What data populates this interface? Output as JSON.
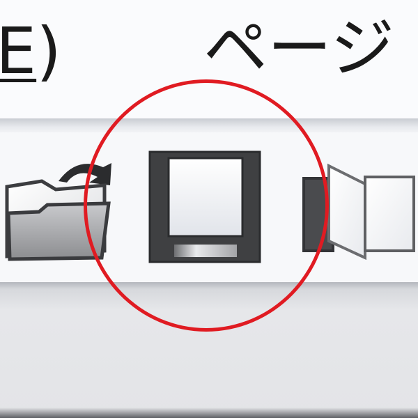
{
  "menubar": {
    "edit_label": "E)",
    "edit_mnemonic": "E",
    "edit_close": ")",
    "page_label": "ページ"
  },
  "toolbar": {
    "buttons": [
      {
        "icon": "folder-open-icon"
      },
      {
        "icon": "floppy-disk-icon"
      },
      {
        "icon": "page-next-icon"
      }
    ]
  },
  "annotation": {
    "color": "#e01b22"
  }
}
